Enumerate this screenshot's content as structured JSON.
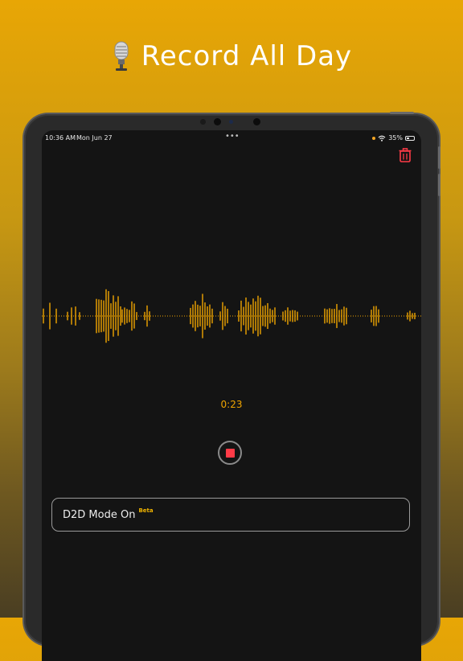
{
  "headline": {
    "emoji_icon": "microphone-icon",
    "text": "Record All Day"
  },
  "status_bar": {
    "time": "10:36 AM",
    "date": "Mon Jun 27",
    "battery": "35%",
    "battery_level": 0.35
  },
  "recorder": {
    "elapsed": "0:23"
  },
  "d2d": {
    "label": "D2D Mode On",
    "badge": "Beta"
  },
  "colors": {
    "accent": "#f0a500",
    "stop": "#ff3b47",
    "trash": "#ff3b47"
  }
}
